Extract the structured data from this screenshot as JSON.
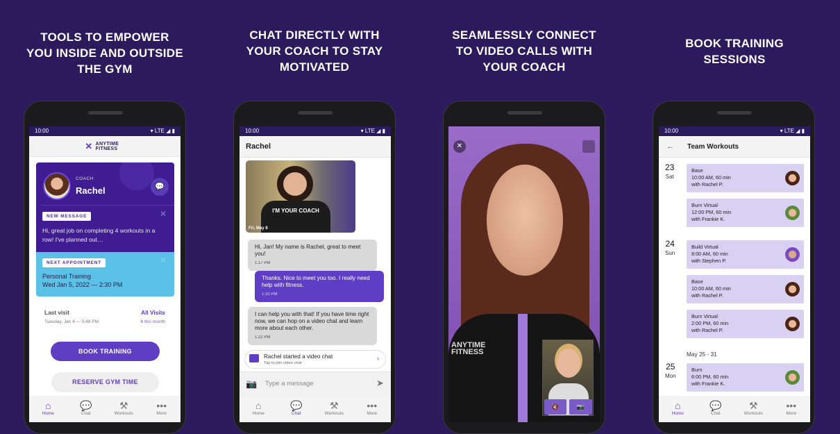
{
  "headlines": [
    [
      "TOOLS TO EMPOWER",
      "YOU INSIDE AND OUTSIDE",
      "THE GYM"
    ],
    [
      "CHAT DIRECTLY WITH",
      "YOUR COACH TO STAY",
      "MOTIVATED"
    ],
    [
      "SEAMLESSLY CONNECT",
      "TO VIDEO CALLS WITH",
      "YOUR COACH"
    ],
    [
      "BOOK TRAINING",
      "SESSIONS"
    ]
  ],
  "status": {
    "time": "10:00",
    "network": "▾ LTE ◢ ▮"
  },
  "nav": [
    {
      "label": "Home",
      "icon": "⌂"
    },
    {
      "label": "Chat",
      "icon": "💬"
    },
    {
      "label": "Workouts",
      "icon": "⚒"
    },
    {
      "label": "More",
      "icon": "•••"
    }
  ],
  "colors": {
    "background": "#2b1a5c",
    "primary": "#5f3dc4",
    "coach_card": "#3f1c92",
    "appointment": "#5bc1e6",
    "workout_card": "#d8d1f2"
  },
  "home": {
    "logo": "ANYTIME FITNESS",
    "coach_label": "COACH",
    "coach_name": "Rachel",
    "new_message_badge": "NEW MESSAGE",
    "message": "Hi, great job on completing 4 workouts in a row! I've planned out…",
    "next_appointment_badge": "NEXT APPOINTMENT",
    "appointment_title": "Personal Training",
    "appointment_time": "Wed Jan 5, 2022 — 2:30 PM",
    "last_visit_label": "Last visit",
    "last_visit_time": "Tuesday, Jan 4 — 5:48 PM",
    "all_visits": "All Visits",
    "visits_count": "6 this month",
    "book_training": "BOOK TRAINING",
    "reserve_gym": "RESERVE GYM TIME"
  },
  "chat": {
    "title": "Rachel",
    "photo_date": "Fri, May 8",
    "photo_shirt": "I'M YOUR COACH",
    "messages": [
      {
        "from": "coach",
        "text": "Hi, Jan! My name is Rachel, great to meet you!",
        "time": "1:17 PM"
      },
      {
        "from": "me",
        "text": "Thanks. Nice to meet you too. I really need help with fitness.",
        "time": "1:20 PM"
      },
      {
        "from": "coach",
        "text": "I can help you with that! If you have time right now, we can hop on a video chat and learn more about each other.",
        "time": "1:22 PM"
      }
    ],
    "video_notice": "Rachel started a video chat",
    "video_notice_sub": "Tap to join video chat",
    "input_placeholder": "Type a message"
  },
  "video": {
    "shirt_logo": "ANYTIME FITNESS"
  },
  "workouts": {
    "title": "Team Workouts",
    "days": [
      {
        "num": "23",
        "day": "Sat"
      },
      {
        "num": "24",
        "day": "Sun"
      },
      {
        "num": "25",
        "day": "Mon"
      }
    ],
    "week_label": "May 25 - 31",
    "sessions": [
      {
        "name": "Base",
        "time": "10:00 AM, 60 min",
        "coach": "with Rachel P."
      },
      {
        "name": "Burn Virtual",
        "time": "12:00 PM, 60 min",
        "coach": "with Frankie K."
      },
      {
        "name": "Build Virtual",
        "time": "8:00 AM, 60 min",
        "coach": "with Stephen P."
      },
      {
        "name": "Base",
        "time": "10:00 AM, 60 min",
        "coach": "with Rachel P."
      },
      {
        "name": "Burn Virtual",
        "time": "2:00 PM, 60 min",
        "coach": "with Rachel P."
      },
      {
        "name": "Burn",
        "time": "6:00 PM, 60 min",
        "coach": "with Frankie K."
      }
    ]
  }
}
